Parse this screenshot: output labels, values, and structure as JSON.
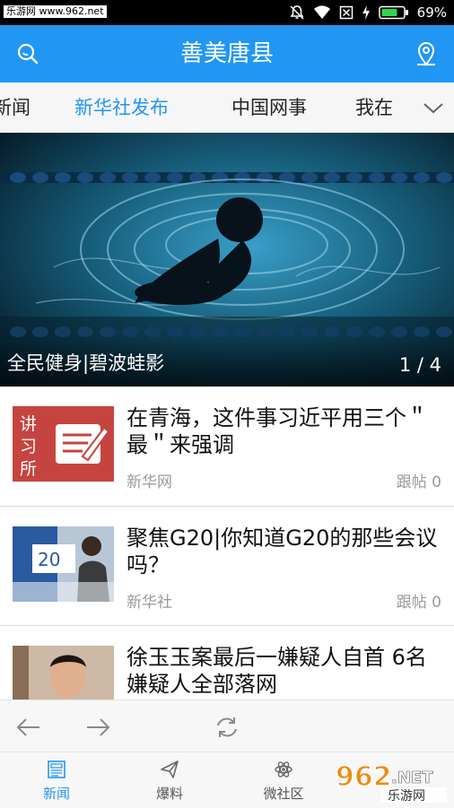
{
  "status_bar": {
    "watermark": "乐游网 www.962.net",
    "battery": "69%",
    "icons": [
      "mute-icon",
      "wifi-icon",
      "no-sim-icon",
      "charging-icon",
      "battery-icon"
    ]
  },
  "app_bar": {
    "title": "善美唐县",
    "left_icon": "search-icon",
    "right_icon": "location-pin-icon"
  },
  "tabs": {
    "items": [
      "新闻",
      "新华社发布",
      "中国网事",
      "我在"
    ],
    "active_index": 1,
    "more_icon": "chevron-down-icon"
  },
  "hero": {
    "caption": "全民健身|碧波蛙影",
    "page_indicator": "1 / 4"
  },
  "news": [
    {
      "title": "在青海，这件事习近平用三个＂最＂来强调",
      "source": "新华网",
      "comments": "跟帖 0",
      "thumb_text": "讲习所"
    },
    {
      "title": "聚焦G20|你知道G20的那些会议吗？",
      "source": "新华社",
      "comments": "跟帖 0",
      "thumb_text": "20"
    },
    {
      "title": "徐玉玉案最后一嫌疑人自首 6名嫌疑人全部落网",
      "source": "",
      "comments": "",
      "thumb_text": ""
    }
  ],
  "browser_bar": {
    "icons": [
      "back-arrow-icon",
      "forward-arrow-icon",
      "refresh-icon"
    ]
  },
  "bottom_nav": {
    "items": [
      {
        "label": "新闻",
        "icon": "newspaper-icon"
      },
      {
        "label": "爆料",
        "icon": "paper-plane-icon"
      },
      {
        "label": "微社区",
        "icon": "atom-icon"
      }
    ],
    "active_index": 0
  },
  "watermark_logo": {
    "number": "962",
    "suffix": ".NET",
    "text": "乐游网"
  },
  "colors": {
    "accent": "#2196f3",
    "status_bar": "#000000",
    "tab_bg": "#f6f6f6"
  }
}
